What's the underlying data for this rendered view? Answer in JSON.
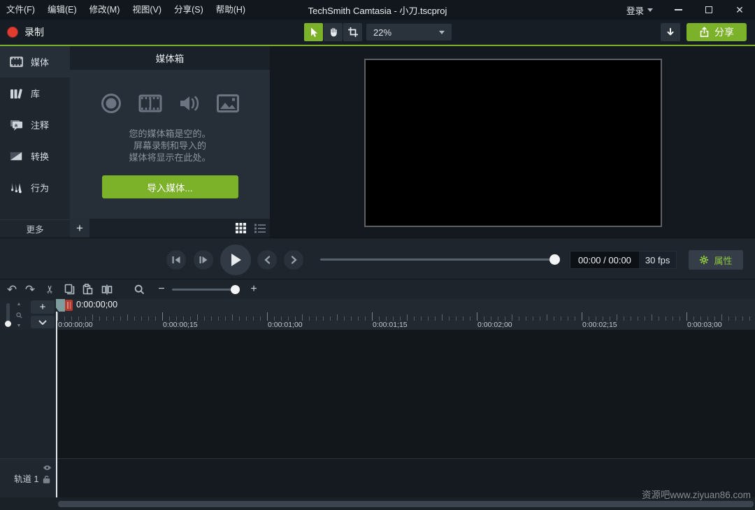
{
  "titlebar": {
    "menu_items": [
      "文件(F)",
      "编辑(E)",
      "修改(M)",
      "视图(V)",
      "分享(S)",
      "帮助(H)"
    ],
    "title": "TechSmith Camtasia - 小刀.tscproj",
    "login_label": "登录"
  },
  "toolbar": {
    "record_label": "录制",
    "canvas_zoom_value": "22%",
    "share_label": "分享"
  },
  "sidebar": {
    "items": [
      {
        "label": "媒体"
      },
      {
        "label": "库"
      },
      {
        "label": "注释"
      },
      {
        "label": "转换"
      },
      {
        "label": "行为"
      }
    ],
    "more_label": "更多"
  },
  "media_bin": {
    "title": "媒体箱",
    "empty_lines": [
      "您的媒体箱是空的。",
      "屏幕录制和导入的",
      "媒体将显示在此处。"
    ],
    "import_button_label": "导入媒体..."
  },
  "playback": {
    "time_display": "00:00 / 00:00",
    "frame_rate": "30 fps",
    "properties_label": "属性"
  },
  "timeline": {
    "playhead_time": "0:00:00;00",
    "ruler_labels": [
      "0:00:00;00",
      "0:00:00;15",
      "0:00:01;00",
      "0:00:01;15",
      "0:00:02;00",
      "0:00:02;15",
      "0:00:03;00"
    ],
    "ruler_label_positions": [
      3,
      153,
      303,
      453,
      603,
      753,
      903
    ],
    "track_name": "轨道 1"
  },
  "watermark": "资源吧www.ziyuan86.com",
  "colors": {
    "accent_green": "#7cb229",
    "accent_text": "#8dc63f",
    "record_red": "#e23b30"
  }
}
